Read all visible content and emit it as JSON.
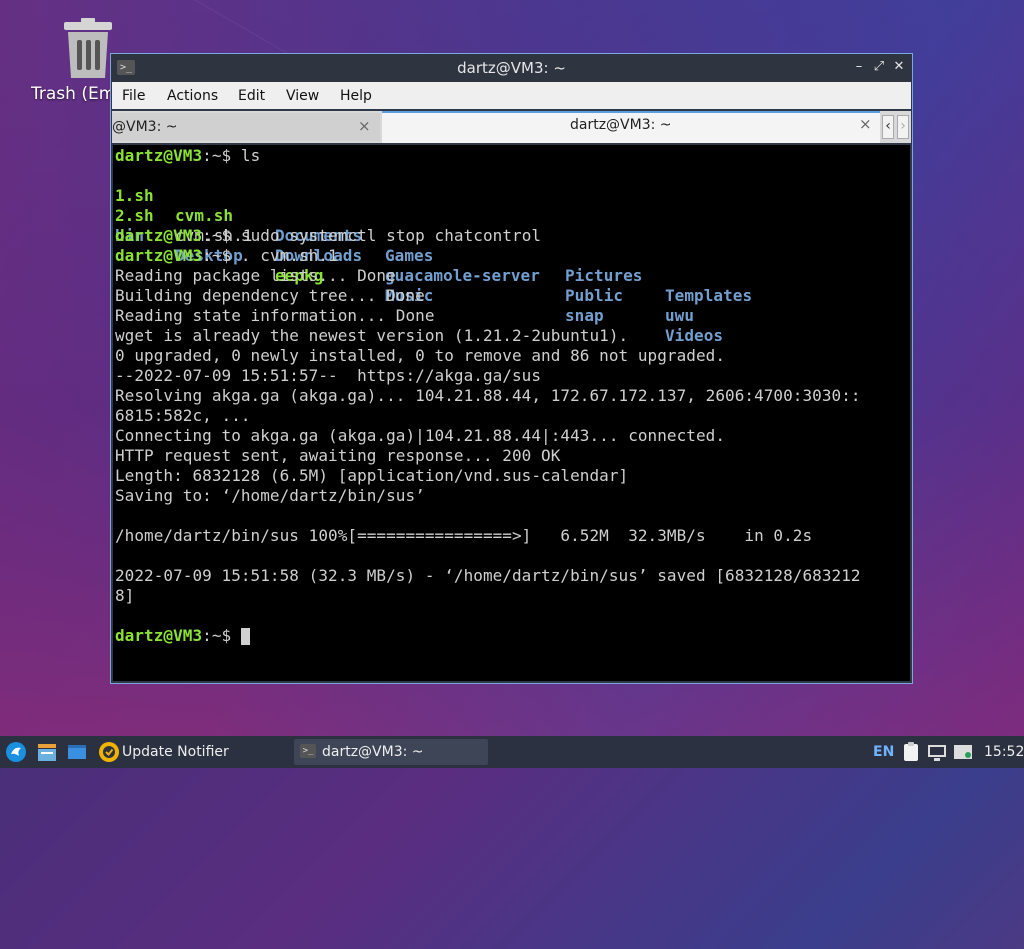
{
  "desktop": {
    "trash_label": "Trash (Em"
  },
  "window": {
    "title": "dartz@VM3: ~",
    "menu": [
      "File",
      "Actions",
      "Edit",
      "View",
      "Help"
    ],
    "tabs": [
      {
        "label": "@VM3: ~",
        "active": false
      },
      {
        "label": "dartz@VM3: ~",
        "active": true
      }
    ],
    "controls": {
      "minimize": "–",
      "maximize": "⤢",
      "close": "✕"
    }
  },
  "terminal": {
    "prompt_user": "dartz@VM3",
    "prompt_path": ":~$ ",
    "ls_cmd": "ls",
    "ls_rows": [
      [
        "1.sh",
        "cvm.sh",
        "Documents",
        "Games",
        "Pictures",
        "Templates"
      ],
      [
        "2.sh",
        "cvm.sh.1",
        "Downloads",
        "guacamole-server",
        "Public",
        "uwu"
      ],
      [
        "bin",
        "Desktop",
        "eepkg",
        "Music",
        "snap",
        "Videos"
      ]
    ],
    "cmd2": "sudo systemctl stop chatcontrol",
    "cmd3": ". cvm.sh.1",
    "output": [
      "Reading package lists... Done",
      "Building dependency tree... Done",
      "Reading state information... Done",
      "wget is already the newest version (1.21.2-2ubuntu1).",
      "0 upgraded, 0 newly installed, 0 to remove and 86 not upgraded.",
      "--2022-07-09 15:51:57--  https://akga.ga/sus",
      "Resolving akga.ga (akga.ga)... 104.21.88.44, 172.67.172.137, 2606:4700:3030::",
      "6815:582c, ...",
      "Connecting to akga.ga (akga.ga)|104.21.88.44|:443... connected.",
      "HTTP request sent, awaiting response... 200 OK",
      "Length: 6832128 (6.5M) [application/vnd.sus-calendar]",
      "Saving to: ‘/home/dartz/bin/sus’",
      "",
      "/home/dartz/bin/sus 100%[================>]   6.52M  32.3MB/s    in 0.2s",
      "",
      "2022-07-09 15:51:58 (32.3 MB/s) - ‘/home/dartz/bin/sus’ saved [6832128/683212",
      "8]",
      ""
    ]
  },
  "taskbar": {
    "update_notifier": "Update Notifier",
    "task_label": "dartz@VM3: ~",
    "lang": "EN",
    "clock": "15:52"
  },
  "colors": {
    "prompt_green": "#8ae234",
    "dir_blue": "#729fcf",
    "terminal_bg": "#000000",
    "taskbar_bg": "#2b3140"
  }
}
